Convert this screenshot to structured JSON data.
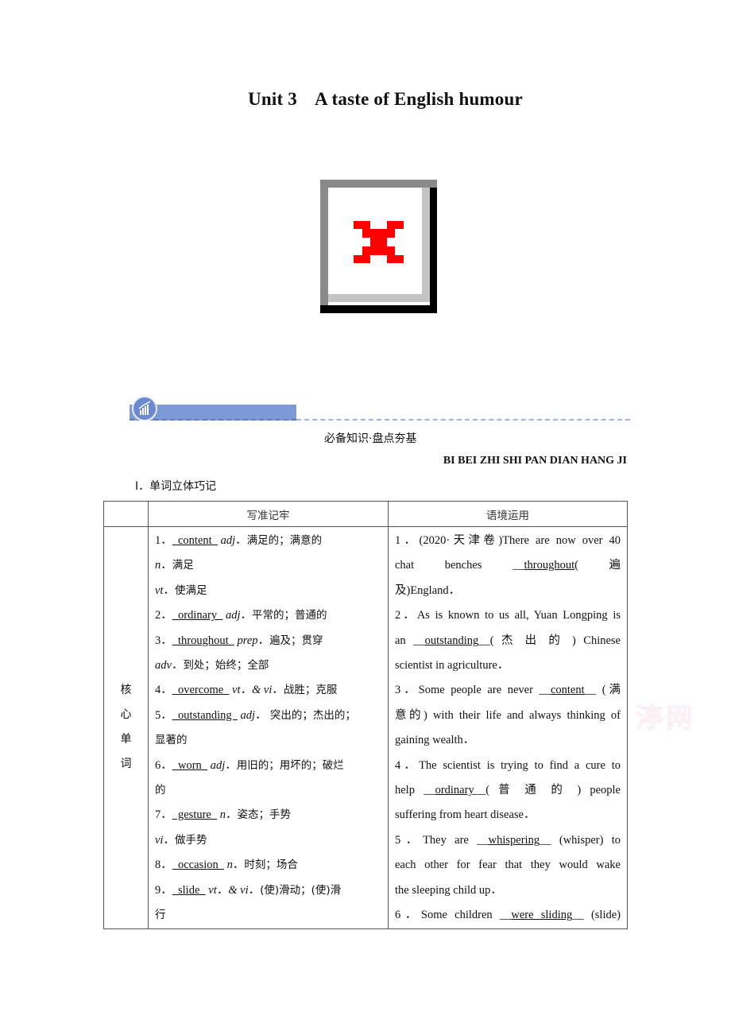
{
  "document": {
    "title_unit": "Unit 3",
    "title_text": "A taste of English humour",
    "image_placeholder": "broken-image-icon",
    "section": {
      "icon": "chart-growth-icon",
      "title_cn": "必备知识·盘点夯基",
      "title_pinyin": "BI BEI ZHI SHI PAN DIAN HANG JI"
    },
    "part_label": "Ⅰ．单词立体巧记",
    "table": {
      "headers": [
        "",
        "写准记牢",
        "语境运用"
      ],
      "category": [
        "核",
        "心",
        "单",
        "词"
      ],
      "write_lines": [
        {
          "num": "1．",
          "answer": "content",
          "pos": "adj",
          "meaning": "满足的；满意的"
        },
        {
          "num": "",
          "answer": "",
          "pos": "n",
          "meaning": "满足"
        },
        {
          "num": "",
          "answer": "",
          "pos": "vt",
          "meaning": "使满足"
        },
        {
          "num": "2．",
          "answer": "ordinary",
          "pos": "adj",
          "meaning": "平常的；普通的"
        },
        {
          "num": "3．",
          "answer": "throughout",
          "pos": "prep",
          "meaning": "遍及；贯穿"
        },
        {
          "num": "",
          "answer": "",
          "pos": "adv",
          "meaning": "到处；始终；全部"
        },
        {
          "num": "4．",
          "answer": "overcome",
          "pos": "vt．& vi",
          "meaning": "战胜；克服"
        },
        {
          "num": "5．",
          "answer": "outstanding",
          "pos": "adj",
          "meaning": "  突出的；杰出的；"
        },
        {
          "num": "",
          "answer": "",
          "pos": "",
          "meaning": "显著的"
        },
        {
          "num": "6．",
          "answer": "worn",
          "pos": "adj",
          "meaning": "用旧的；用坏的；破烂"
        },
        {
          "num": "",
          "answer": "",
          "pos": "",
          "meaning": "的"
        },
        {
          "num": "7．",
          "answer": "gesture",
          "pos": "n",
          "meaning": "姿态；手势"
        },
        {
          "num": "",
          "answer": "",
          "pos": "vi",
          "meaning": "做手势"
        },
        {
          "num": "8．",
          "answer": "occasion",
          "pos": "n",
          "meaning": "时刻；场合"
        },
        {
          "num": "9．",
          "answer": "slide",
          "pos": "vt．& vi",
          "meaning": "(使)滑动；(使)滑"
        },
        {
          "num": "",
          "answer": "",
          "pos": "",
          "meaning": "行"
        }
      ],
      "context_lines": [
        {
          "pre": "1．(2020·天津卷)There are now over 40",
          "answer": "",
          "post": ""
        },
        {
          "pre": "chat benches __",
          "answer": "throughout",
          "post": "( 遍"
        },
        {
          "pre": "及)England．",
          "answer": "",
          "post": "",
          "last": true
        },
        {
          "pre": "2．As is known to us all, Yuan Longping is",
          "answer": "",
          "post": ""
        },
        {
          "pre": "an __",
          "answer": "outstanding",
          "post": "__( 杰 出 的 ) Chinese"
        },
        {
          "pre": "scientist in agriculture．",
          "answer": "",
          "post": "",
          "last": true
        },
        {
          "pre": "3．Some people are never __",
          "answer": "content",
          "post": "__ (满"
        },
        {
          "pre": "意的) with their life and always thinking of",
          "answer": "",
          "post": ""
        },
        {
          "pre": "gaining wealth．",
          "answer": "",
          "post": "",
          "last": true
        },
        {
          "pre": "4．The scientist is trying to find a cure to",
          "answer": "",
          "post": ""
        },
        {
          "pre": "help __",
          "answer": "ordinary",
          "post": "__( 普 通 的 ) people"
        },
        {
          "pre": "suffering from heart disease．",
          "answer": "",
          "post": "",
          "last": true
        },
        {
          "pre": "5．They are __",
          "answer": "whispering",
          "post": "__ (whisper) to"
        },
        {
          "pre": "each other for fear that they would wake",
          "answer": "",
          "post": ""
        },
        {
          "pre": "the sleeping child up．",
          "answer": "",
          "post": "",
          "last": true
        },
        {
          "pre": "6．Some children __",
          "answer": "were sliding",
          "post": "__ (slide)"
        }
      ]
    },
    "watermark": "渟网"
  }
}
